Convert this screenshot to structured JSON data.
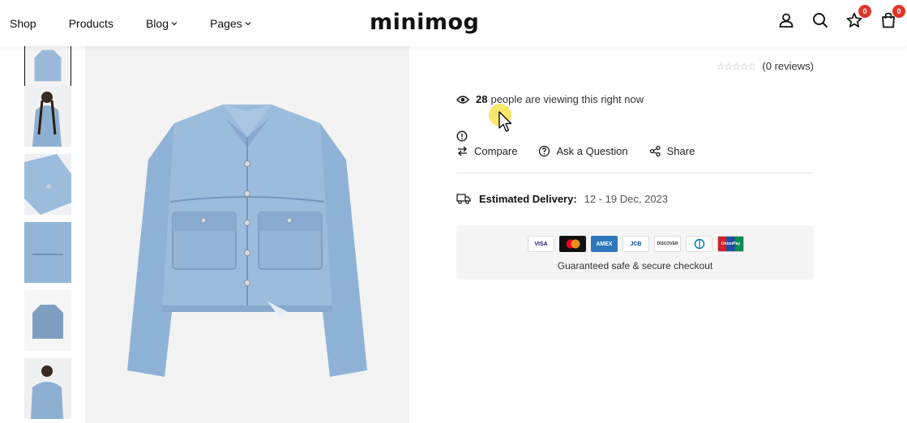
{
  "header": {
    "nav": [
      {
        "label": "Shop"
      },
      {
        "label": "Products"
      },
      {
        "label": "Blog"
      },
      {
        "label": "Pages"
      }
    ],
    "logo": "minimog",
    "wishlist_count": "0",
    "cart_count": "0"
  },
  "product": {
    "reviews_text": "(0 reviews)",
    "viewing_count": "28",
    "viewing_text": "people are viewing this right now",
    "actions": {
      "compare": "Compare",
      "ask": "Ask a Question",
      "share": "Share"
    },
    "delivery_label": "Estimated Delivery:",
    "delivery_value": "12 - 19 Dec, 2023",
    "payment_cards": [
      "VISA",
      "Mastercard",
      "AMEX",
      "JCB",
      "DISCOVER",
      "Diners",
      "UnionPay"
    ],
    "secure_text": "Guaranteed safe & secure checkout"
  },
  "colors": {
    "accent_badge": "#e0342b",
    "denim": "#8fb3d6"
  }
}
